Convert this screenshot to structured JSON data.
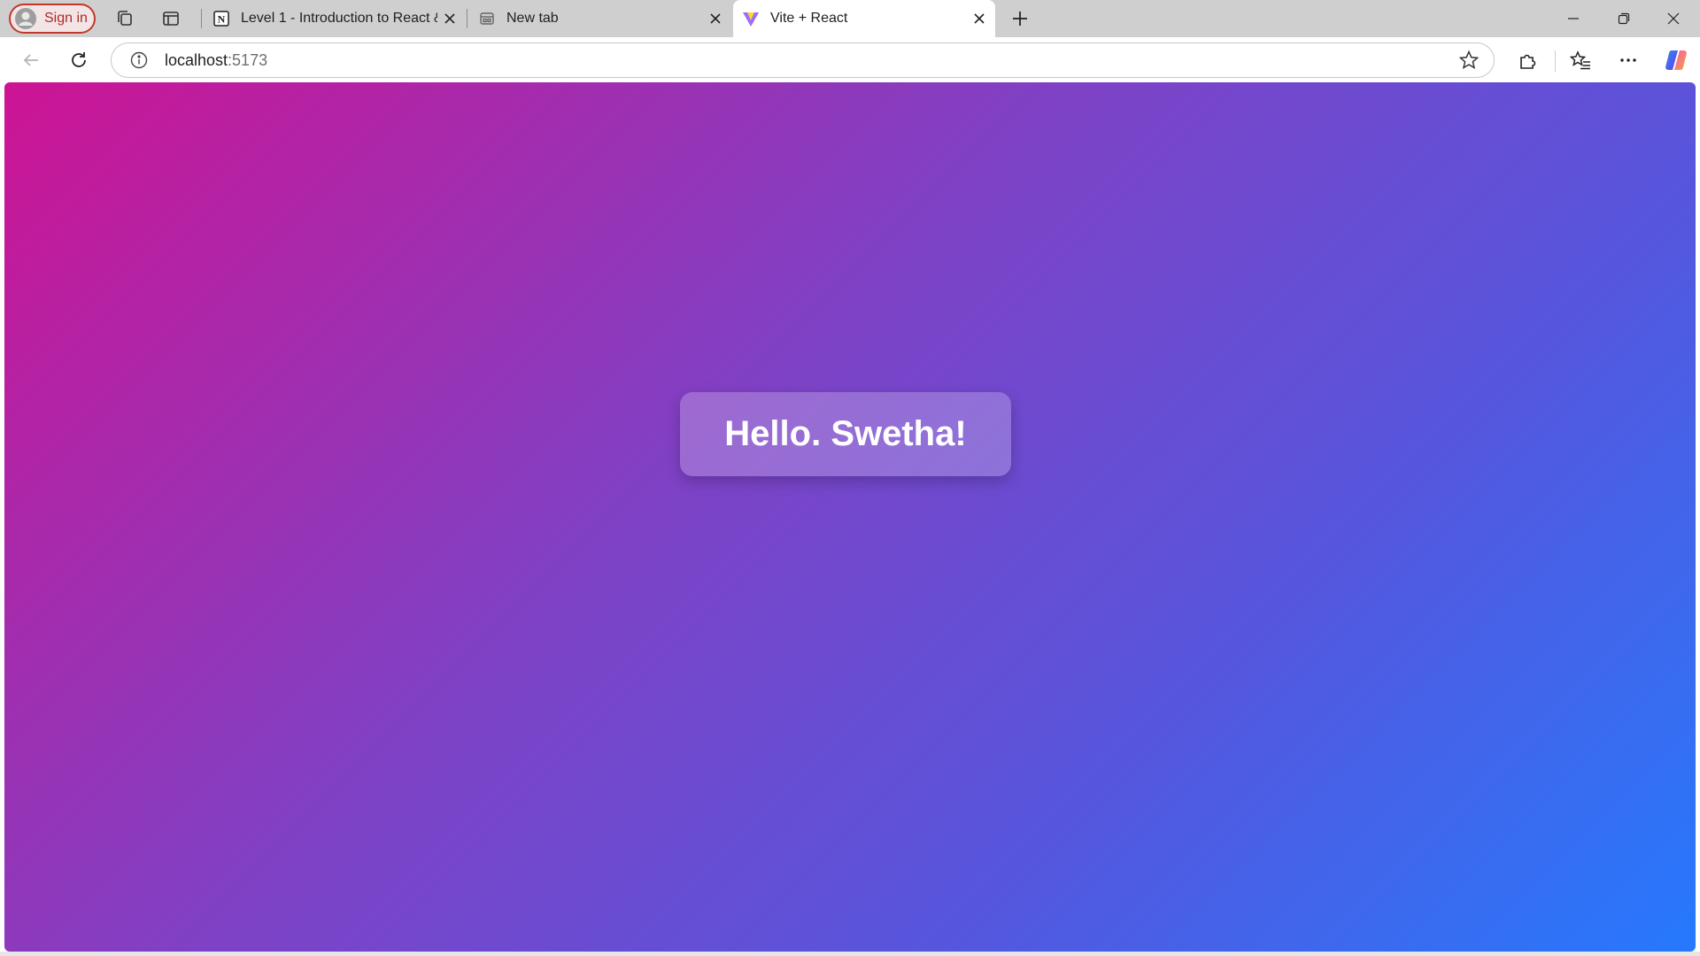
{
  "browser": {
    "sign_in_label": "Sign in",
    "tabs": [
      {
        "title": "Level 1 - Introduction to React &",
        "favicon": "notion-icon",
        "active": false
      },
      {
        "title": "New tab",
        "favicon": "new-tab-page-icon",
        "active": false
      },
      {
        "title": "Vite + React",
        "favicon": "vite-icon",
        "active": true
      }
    ],
    "address": {
      "host": "localhost",
      "port": ":5173"
    }
  },
  "page": {
    "greeting": "Hello. Swetha!",
    "gradient_colors": [
      "#cd1494",
      "#7e42c6",
      "#5656dd",
      "#2679fd"
    ]
  },
  "icons": {
    "sign_in": "profile-icon",
    "workspaces": "workspaces-icon",
    "tab_actions": "vertical-tabs-icon",
    "new_tab": "plus-icon",
    "back": "back-arrow-icon",
    "refresh": "refresh-icon",
    "site_info": "info-icon",
    "favorite": "star-icon",
    "extensions": "puzzle-icon",
    "favorites_list": "favorites-icon",
    "more": "ellipsis-icon",
    "copilot": "copilot-icon"
  }
}
